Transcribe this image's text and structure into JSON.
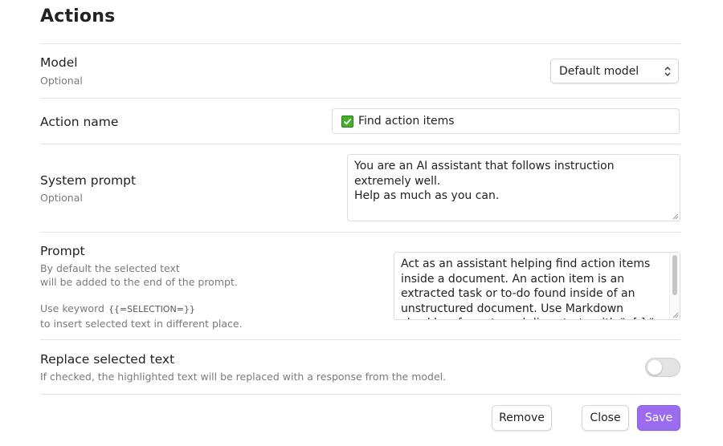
{
  "page": {
    "title": "Actions"
  },
  "model": {
    "label": "Model",
    "hint": "Optional",
    "selected": "Default model"
  },
  "action_name": {
    "label": "Action name",
    "emoji_icon": "green-check-emoji",
    "value": "Find action items"
  },
  "system_prompt": {
    "label": "System prompt",
    "hint": "Optional",
    "value": "You are an AI assistant that follows instruction extremely well.\nHelp as much as you can."
  },
  "prompt": {
    "label": "Prompt",
    "hint_line1": "By default the selected text",
    "hint_line2": "will be added to the end of the prompt.",
    "keyword_prefix": "Use keyword",
    "keyword": "{{=SELECTION=}}",
    "keyword_suffix": "to insert selected text in different place.",
    "value": "Act as an assistant helping find action items inside a document. An action item is an extracted task or to-do found inside of an unstructured document. Use Markdown checkbox format: each line starts with \"- [ ] \""
  },
  "replace_selected": {
    "label": "Replace selected text",
    "hint": "If checked, the highlighted text will be replaced with a response from the model.",
    "enabled": false
  },
  "buttons": {
    "remove": "Remove",
    "close": "Close",
    "save": "Save"
  },
  "colors": {
    "accent": "#9b6cf0",
    "check_green": "#43b02a"
  }
}
